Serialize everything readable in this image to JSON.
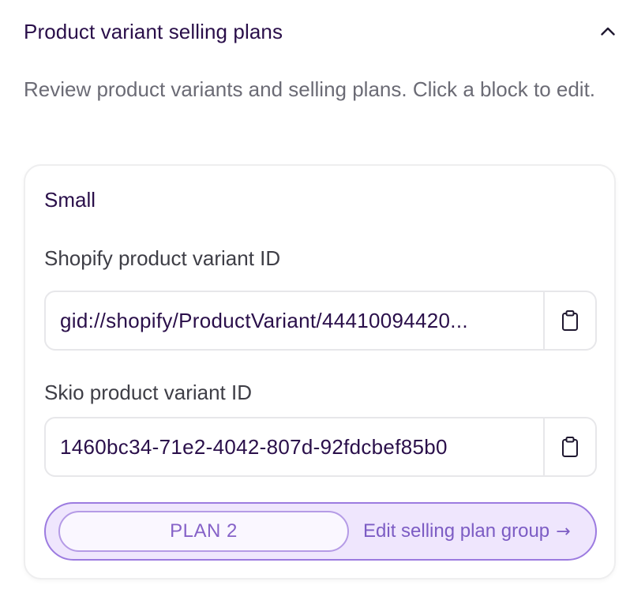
{
  "section": {
    "title": "Product variant selling plans",
    "description": "Review product variants and selling plans. Click a block to edit."
  },
  "variant": {
    "name": "Small",
    "shopify_label": "Shopify product variant ID",
    "shopify_value": "gid://shopify/ProductVariant/44410094420...",
    "skio_label": "Skio product variant ID",
    "skio_value": "1460bc34-71e2-4042-807d-92fdcbef85b0"
  },
  "plan": {
    "name": "PLAN 2",
    "edit_label": "Edit selling plan group",
    "edit_arrow": "→"
  },
  "icons": {
    "collapse": "chevron-up-icon",
    "copy": "clipboard-icon"
  },
  "colors": {
    "title": "#2a0f4a",
    "muted_text": "#6b6b75",
    "accent_border": "#9c7be0",
    "accent_fill": "#efe6fd",
    "accent_text": "#7c5cc4"
  }
}
